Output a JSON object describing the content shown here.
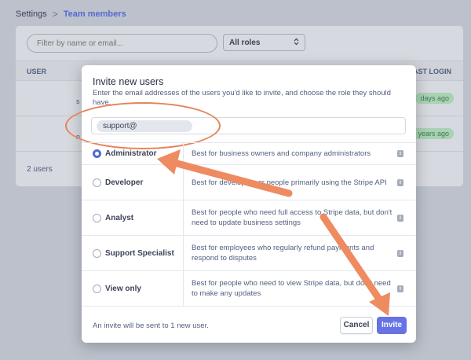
{
  "breadcrumb": {
    "root": "Settings",
    "separator": ">",
    "current": "Team members"
  },
  "background": {
    "filter_placeholder": "Filter by name or email...",
    "roles_filter": "All roles",
    "columns": {
      "user": "USER",
      "last_login": "AST LOGIN"
    },
    "rows": [
      {
        "fragment": "s",
        "last_login": "days ago"
      },
      {
        "fragment": "n",
        "last_login": "t years ago"
      }
    ],
    "count": "2 users"
  },
  "modal": {
    "title": "Invite new users",
    "description": "Enter the email addresses of the users you'd like to invite, and choose the role they should have.",
    "email_value": "support@",
    "roles": [
      {
        "name": "Administrator",
        "description": "Best for business owners and company administrators",
        "checked": true
      },
      {
        "name": "Developer",
        "description": "Best for developers or people primarily using the Stripe API",
        "checked": false
      },
      {
        "name": "Analyst",
        "description": "Best for people who need full access to Stripe data, but don't need to update business settings",
        "checked": false
      },
      {
        "name": "Support Specialist",
        "description": "Best for employees who regularly refund payments and respond to disputes",
        "checked": false
      },
      {
        "name": "View only",
        "description": "Best for people who need to view Stripe data, but don't need to make any updates",
        "checked": false
      }
    ],
    "info_glyph": "i",
    "footer_text": "An invite will be sent to 1 new user.",
    "cancel_label": "Cancel",
    "invite_label": "Invite"
  },
  "colors": {
    "accent": "#5469d4",
    "primary_button": "#6772e5",
    "annotation": "#e8825a"
  }
}
